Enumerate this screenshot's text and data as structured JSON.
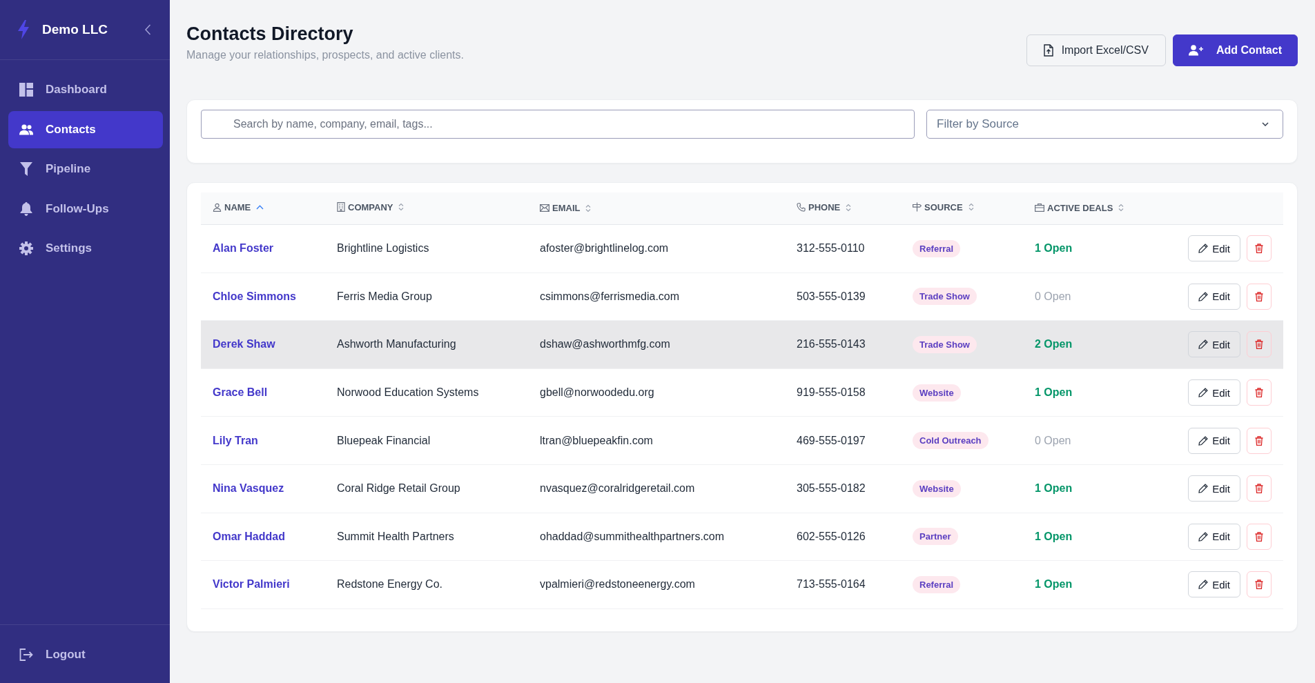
{
  "sidebar": {
    "brand": "Demo LLC",
    "items": [
      {
        "label": "Dashboard",
        "selected": false
      },
      {
        "label": "Contacts",
        "selected": true
      },
      {
        "label": "Pipeline",
        "selected": false
      },
      {
        "label": "Follow-Ups",
        "selected": false
      },
      {
        "label": "Settings",
        "selected": false
      }
    ],
    "logout": "Logout"
  },
  "header": {
    "title": "Contacts Directory",
    "subtitle": "Manage your relationships, prospects, and active clients.",
    "buttons": [
      {
        "label": "Import Excel/CSV",
        "kind": "secondary"
      },
      {
        "label": "Add Contact",
        "kind": "primary"
      }
    ]
  },
  "filters": {
    "search": {
      "placeholder": "Search by name, company, email, tags..."
    },
    "source_filter": {
      "placeholder": "Filter by Source"
    }
  },
  "table": {
    "columns": [
      {
        "label": "NAME",
        "sorted": true
      },
      {
        "label": "COMPANY",
        "sorted": false
      },
      {
        "label": "EMAIL",
        "sorted": false
      },
      {
        "label": "PHONE",
        "sorted": false
      },
      {
        "label": "SOURCE",
        "sorted": false
      },
      {
        "label": "ACTIVE DEALS",
        "sorted": false
      }
    ],
    "rows": [
      {
        "name": "Alan Foster",
        "company": "Brightline Logistics",
        "email": "afoster@brightlinelog.com",
        "phone": "312-555-0110",
        "source": "Referral",
        "deals": "1 Open",
        "has_open_deals": true,
        "highlighted": false,
        "edit_label": "Edit"
      },
      {
        "name": "Chloe Simmons",
        "company": "Ferris Media Group",
        "email": "csimmons@ferrismedia.com",
        "phone": "503-555-0139",
        "source": "Trade Show",
        "deals": "0 Open",
        "has_open_deals": false,
        "highlighted": false,
        "edit_label": "Edit"
      },
      {
        "name": "Derek Shaw",
        "company": "Ashworth Manufacturing",
        "email": "dshaw@ashworthmfg.com",
        "phone": "216-555-0143",
        "source": "Trade Show",
        "deals": "2 Open",
        "has_open_deals": true,
        "highlighted": true,
        "edit_label": "Edit"
      },
      {
        "name": "Grace Bell",
        "company": "Norwood Education Systems",
        "email": "gbell@norwoodedu.org",
        "phone": "919-555-0158",
        "source": "Website",
        "deals": "1 Open",
        "has_open_deals": true,
        "highlighted": false,
        "edit_label": "Edit"
      },
      {
        "name": "Lily Tran",
        "company": "Bluepeak Financial",
        "email": "ltran@bluepeakfin.com",
        "phone": "469-555-0197",
        "source": "Cold Outreach",
        "deals": "0 Open",
        "has_open_deals": false,
        "highlighted": false,
        "edit_label": "Edit"
      },
      {
        "name": "Nina Vasquez",
        "company": "Coral Ridge Retail Group",
        "email": "nvasquez@coralridgeretail.com",
        "phone": "305-555-0182",
        "source": "Website",
        "deals": "1 Open",
        "has_open_deals": true,
        "highlighted": false,
        "edit_label": "Edit"
      },
      {
        "name": "Omar Haddad",
        "company": "Summit Health Partners",
        "email": "ohaddad@summithealthpartners.com",
        "phone": "602-555-0126",
        "source": "Partner",
        "deals": "1 Open",
        "has_open_deals": true,
        "highlighted": false,
        "edit_label": "Edit"
      },
      {
        "name": "Victor Palmieri",
        "company": "Redstone Energy Co.",
        "email": "vpalmieri@redstoneenergy.com",
        "phone": "713-555-0164",
        "source": "Referral",
        "deals": "1 Open",
        "has_open_deals": true,
        "highlighted": false,
        "edit_label": "Edit"
      }
    ]
  }
}
